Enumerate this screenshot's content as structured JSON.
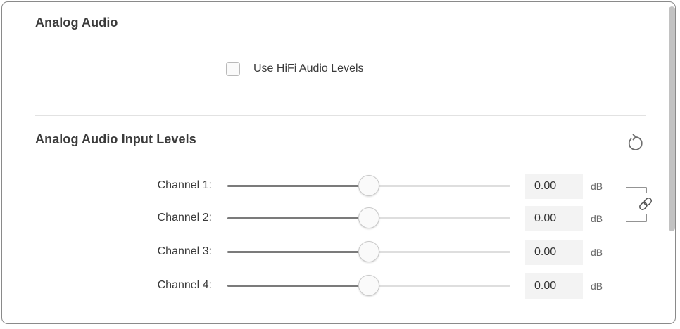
{
  "analog_audio": {
    "title": "Analog Audio",
    "hifi_checkbox": {
      "label": "Use HiFi Audio Levels",
      "checked": false
    }
  },
  "input_levels": {
    "title": "Analog Audio Input Levels",
    "reset_icon": "reset-icon",
    "link_icon": "link-icon",
    "unit": "dB",
    "channels": [
      {
        "label": "Channel 1:",
        "value": "0.00",
        "level_fraction": 0.5
      },
      {
        "label": "Channel 2:",
        "value": "0.00",
        "level_fraction": 0.5
      },
      {
        "label": "Channel 3:",
        "value": "0.00",
        "level_fraction": 0.5
      },
      {
        "label": "Channel 4:",
        "value": "0.00",
        "level_fraction": 0.5
      }
    ]
  },
  "colors": {
    "track_fill": "#7b7b7b",
    "track_empty": "#dedede",
    "field_bg": "#f3f3f3"
  }
}
